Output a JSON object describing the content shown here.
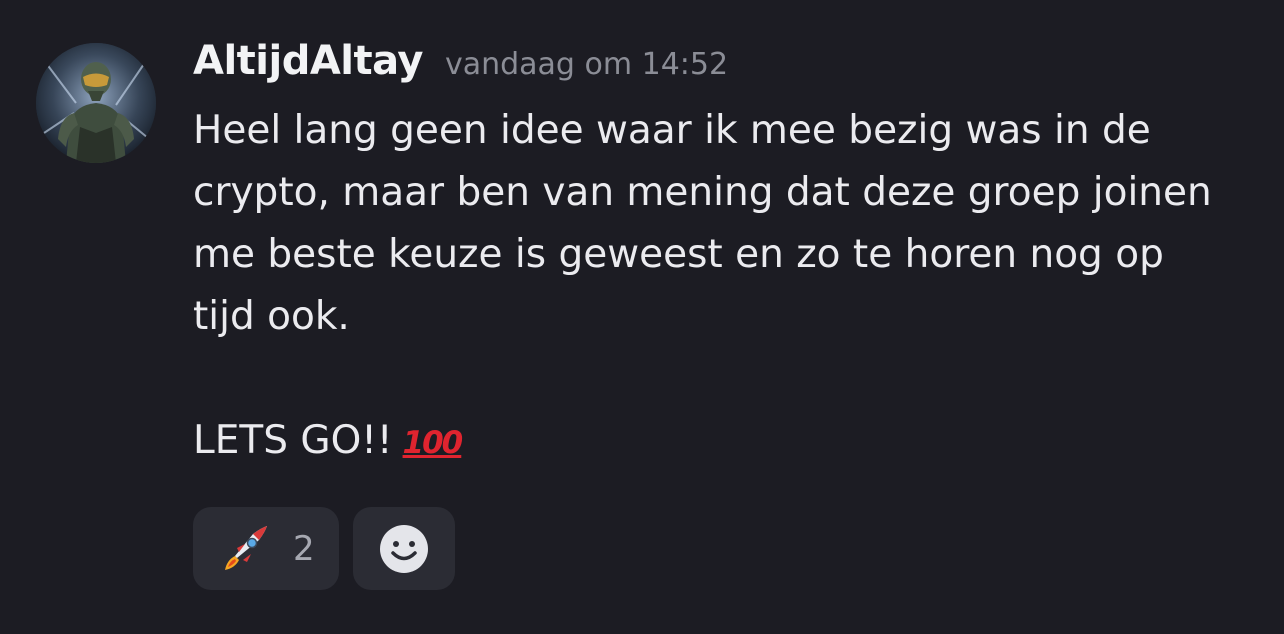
{
  "message": {
    "author": "AltijdAltay",
    "timestamp": "vandaag om 14:52",
    "lines": [
      "Heel lang geen idee waar ik mee bezig was in de",
      "crypto, maar ben van mening dat deze groep joinen",
      "me beste keuze is geweest en zo te horen nog op",
      "tijd ook."
    ],
    "final_line": "LETS GO!!",
    "final_emoji": "100"
  },
  "reactions": [
    {
      "icon": "rocket-icon",
      "count": "2"
    }
  ],
  "add_reaction": {
    "icon": "smiley-face-icon"
  },
  "colors": {
    "background": "#1c1c23",
    "text": "#ebebef",
    "username": "#f2f3f5",
    "timestamp": "#8b8d96",
    "reaction_bg": "#2b2c34",
    "emoji_100": "#e0242f"
  }
}
